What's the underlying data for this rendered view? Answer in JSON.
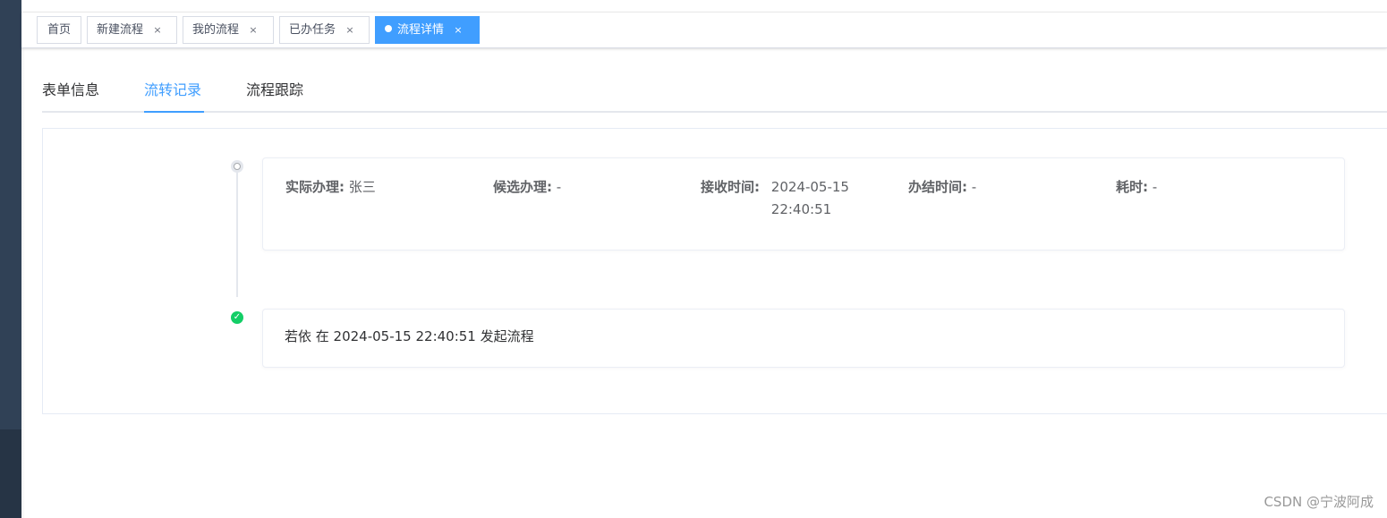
{
  "tags": {
    "items": [
      {
        "label": "首页",
        "closable": false
      },
      {
        "label": "新建流程",
        "closable": true
      },
      {
        "label": "我的流程",
        "closable": true
      },
      {
        "label": "已办任务",
        "closable": true
      },
      {
        "label": "流程详情",
        "closable": true,
        "active": true
      }
    ],
    "close_glyph": "×"
  },
  "tabs": {
    "items": [
      "表单信息",
      "流转记录",
      "流程跟踪"
    ],
    "active": "流转记录"
  },
  "timeline": {
    "node1": {
      "icon": "clock-icon",
      "actual_handler_label": "实际办理:",
      "actual_handler_value": "张三",
      "candidate_label": "候选办理:",
      "candidate_value": "-",
      "receive_time_label": "接收时间:",
      "receive_time_date": "2024-05-15",
      "receive_time_clock": "22:40:51",
      "finish_time_label": "办结时间:",
      "finish_time_value": "-",
      "duration_label": "耗时:",
      "duration_value": "-"
    },
    "node2": {
      "icon": "check-circle-icon",
      "text": "若依 在 2024-05-15 22:40:51 发起流程"
    }
  },
  "colors": {
    "accent": "#409eff",
    "success": "#13ce66",
    "sidebar": "#304156"
  },
  "watermark": "CSDN @宁波阿成"
}
